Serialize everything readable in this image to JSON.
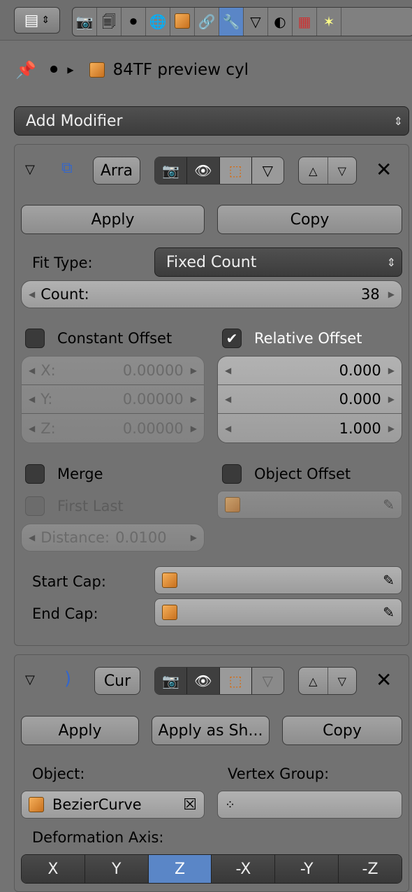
{
  "breadcrumb": {
    "object_name": "84TF preview cyl"
  },
  "header": {
    "tabs": [
      {
        "icon": "render-icon"
      },
      {
        "icon": "render-layers-icon"
      },
      {
        "icon": "scene-icon"
      },
      {
        "icon": "world-icon"
      },
      {
        "icon": "object-icon"
      },
      {
        "icon": "constraints-icon"
      },
      {
        "icon": "modifiers-wrench-icon",
        "active": true
      },
      {
        "icon": "data-mesh-icon"
      },
      {
        "icon": "material-icon"
      },
      {
        "icon": "texture-icon"
      },
      {
        "icon": "particles-icon"
      }
    ],
    "active_color": "#5a86c7"
  },
  "add_modifier": {
    "label": "Add Modifier"
  },
  "array_modifier": {
    "name": "Arra",
    "apply_label": "Apply",
    "copy_label": "Copy",
    "fit_type_label": "Fit Type:",
    "fit_type_value": "Fixed Count",
    "count_label": "Count:",
    "count_value": "38",
    "constant_offset_label": "Constant Offset",
    "relative_offset_label": "Relative Offset",
    "constant": {
      "x_label": "X:",
      "x": "0.00000",
      "y_label": "Y:",
      "y": "0.00000",
      "z_label": "Z:",
      "z": "0.00000"
    },
    "relative": {
      "x": "0.000",
      "y": "0.000",
      "z": "1.000"
    },
    "merge_label": "Merge",
    "object_offset_label": "Object Offset",
    "first_last_label": "First Last",
    "distance_label": "Distance:",
    "distance_value": "0.0100",
    "start_cap_label": "Start Cap:",
    "end_cap_label": "End Cap:"
  },
  "curve_modifier": {
    "name": "Cur",
    "apply_label": "Apply",
    "apply_shape_label": "Apply as Sh...",
    "copy_label": "Copy",
    "object_label": "Object:",
    "object_value": "BezierCurve",
    "vertex_group_label": "Vertex Group:",
    "deformation_axis_label": "Deformation Axis:",
    "axes": [
      "X",
      "Y",
      "Z",
      "-X",
      "-Y",
      "-Z"
    ],
    "active_axis": "Z"
  }
}
